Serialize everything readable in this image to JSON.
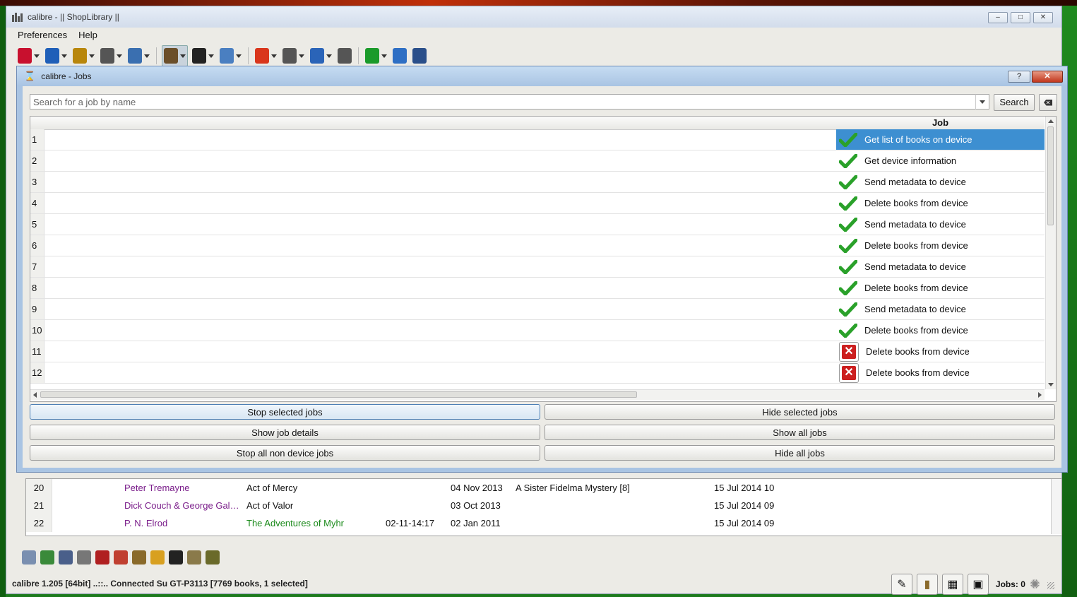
{
  "window": {
    "title": "calibre - || ShopLibrary ||",
    "controls": [
      "–",
      "□",
      "✕"
    ]
  },
  "menu": [
    {
      "label": "Preferences"
    },
    {
      "label": "Help"
    }
  ],
  "toolbar_icons": [
    {
      "name": "add-books-icon",
      "color": "#c8102e",
      "dropdown": true
    },
    {
      "name": "edit-metadata-icon",
      "color": "#1f5fb8",
      "dropdown": true
    },
    {
      "name": "convert-books-icon",
      "color": "#b8860b",
      "dropdown": true
    },
    {
      "name": "search-tool-icon",
      "color": "#555555",
      "dropdown": true
    },
    {
      "name": "view-icon",
      "color": "#3a6fb0",
      "dropdown": true
    },
    {
      "name": "library-icon",
      "color": "#6b4f2a",
      "dropdown": true,
      "selected": true
    },
    {
      "name": "device-icon",
      "color": "#222222",
      "dropdown": true
    },
    {
      "name": "save-to-disk-icon",
      "color": "#4a7fc1",
      "dropdown": true
    },
    {
      "name": "news-icon",
      "color": "#d9361c",
      "dropdown": true
    },
    {
      "name": "connect-share-icon",
      "color": "#555555",
      "dropdown": true
    },
    {
      "name": "get-books-icon",
      "color": "#2a64b8",
      "dropdown": true
    },
    {
      "name": "plugins-icon",
      "color": "#555555",
      "dropdown": false
    },
    {
      "name": "remove-books-icon",
      "color": "#1a9a2a",
      "dropdown": true
    },
    {
      "name": "find-icon",
      "color": "#2e6fc4",
      "dropdown": false
    },
    {
      "name": "preferences-icon",
      "color": "#2a4f8a",
      "dropdown": false
    }
  ],
  "jobs_dialog": {
    "title": "calibre - Jobs",
    "help_label": "?",
    "close_label": "✕",
    "search": {
      "placeholder": "Search for a job by name",
      "value": "",
      "button_label": "Search"
    },
    "column_header": "Job",
    "jobs": [
      {
        "n": "1",
        "name": "Get list of books on device",
        "status": "ok",
        "selected": true
      },
      {
        "n": "2",
        "name": "Get device information",
        "status": "ok"
      },
      {
        "n": "3",
        "name": "Send metadata to device",
        "status": "ok"
      },
      {
        "n": "4",
        "name": "Delete books from device",
        "status": "ok"
      },
      {
        "n": "5",
        "name": "Send metadata to device",
        "status": "ok"
      },
      {
        "n": "6",
        "name": "Delete books from device",
        "status": "ok"
      },
      {
        "n": "7",
        "name": "Send metadata to device",
        "status": "ok"
      },
      {
        "n": "8",
        "name": "Delete books from device",
        "status": "ok"
      },
      {
        "n": "9",
        "name": "Send metadata to device",
        "status": "ok"
      },
      {
        "n": "10",
        "name": "Delete books from device",
        "status": "ok"
      },
      {
        "n": "11",
        "name": "Delete books from device",
        "status": "failed"
      },
      {
        "n": "12",
        "name": "Delete books from device",
        "status": "failed"
      }
    ],
    "buttons": {
      "stop_selected": "Stop selected jobs",
      "hide_selected": "Hide selected jobs",
      "show_details": "Show job details",
      "show_all": "Show all jobs",
      "stop_all_non_device": "Stop all non device jobs",
      "hide_all": "Hide all jobs"
    }
  },
  "books": [
    {
      "n": "20",
      "author": "Peter Tremayne",
      "title": "Act of Mercy",
      "timestamp": "",
      "pubdate": "04 Nov 2013",
      "series": "A Sister Fidelma Mystery [8]",
      "date": "15 Jul 2014 10",
      "title_style": "normal"
    },
    {
      "n": "21",
      "author": "Dick Couch & George Gal…",
      "title": "Act of Valor",
      "timestamp": "",
      "pubdate": "03 Oct 2013",
      "series": "",
      "date": "15 Jul 2014 09",
      "title_style": "normal"
    },
    {
      "n": "22",
      "author": "P. N. Elrod",
      "title": "The Adventures of Myhr",
      "timestamp": "02-11-14:17",
      "pubdate": "02 Jan 2011",
      "series": "",
      "date": "15 Jul 2014 09",
      "title_style": "green"
    }
  ],
  "bottom_toolbar_icons": [
    "preview-icon",
    "library-check-icon",
    "catalog-icon",
    "tweak-icon",
    "annotate-icon",
    "bookmark-icon",
    "epub-icon",
    "clean-icon",
    "text-icon",
    "add-to-library-icon",
    "mark-icon"
  ],
  "status": {
    "text": "calibre 1.205 [64bit] ..::.. Connected Su GT-P3113    [7769 books, 1 selected]",
    "jobs_label": "Jobs: 0"
  }
}
